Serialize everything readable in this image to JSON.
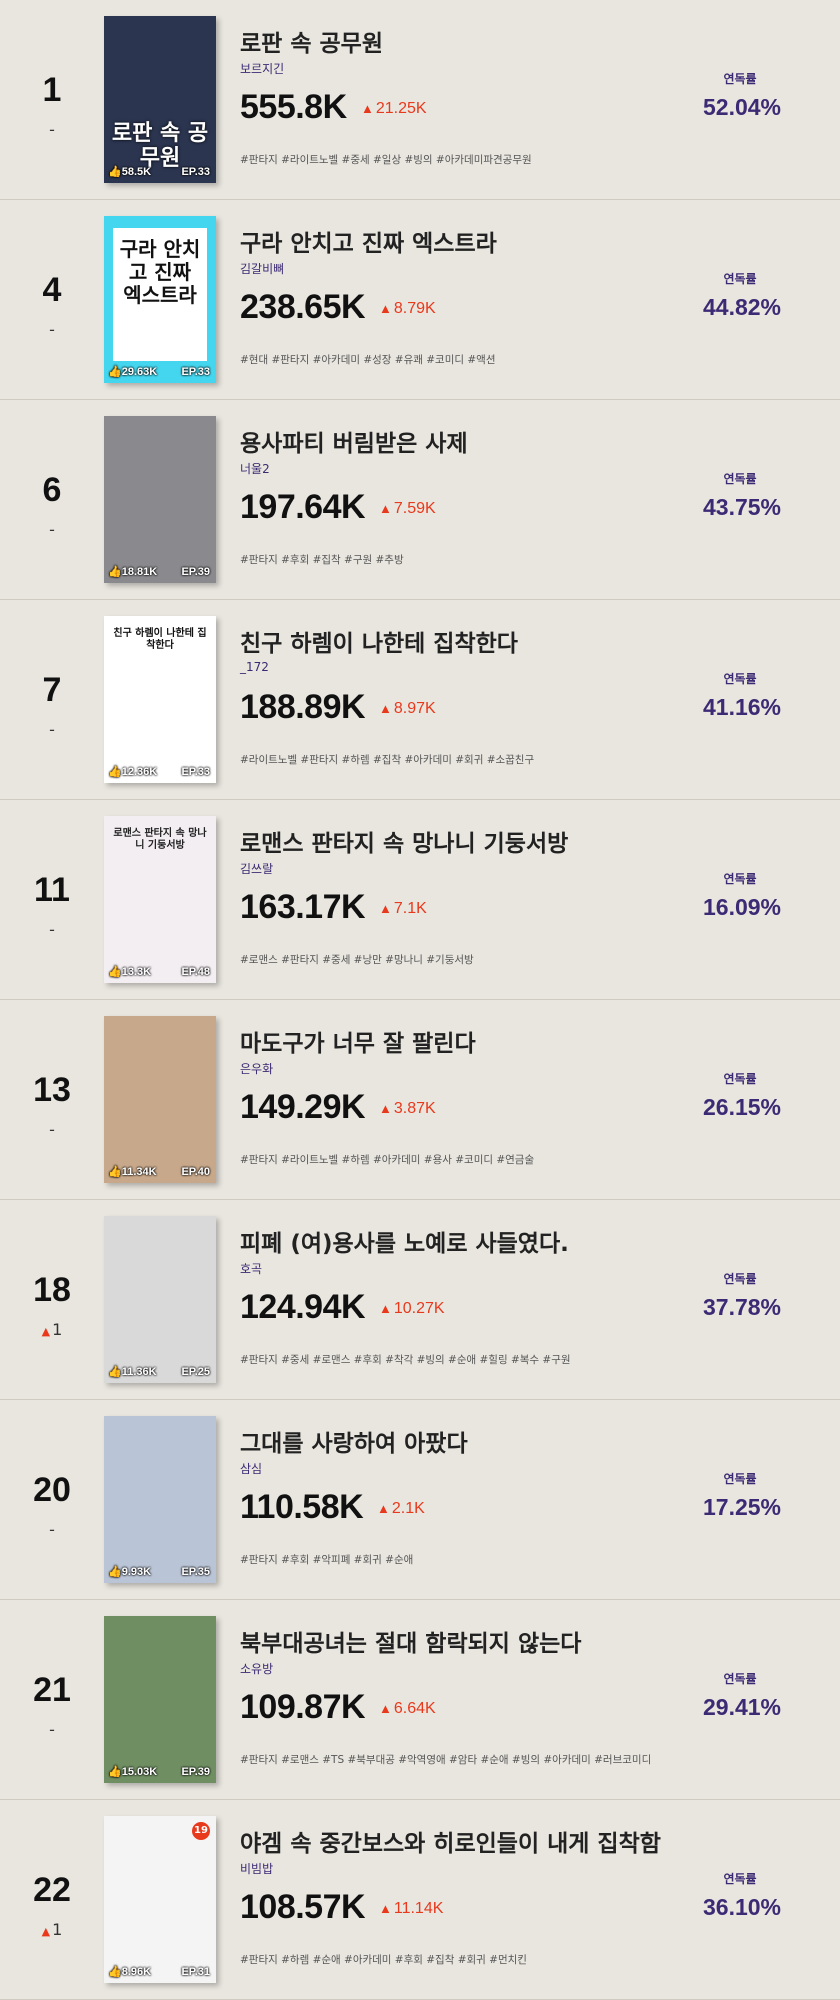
{
  "rows": [
    {
      "rank": "1",
      "change": "-",
      "change_up": false,
      "title": "로판 속 공무원",
      "author": "보르지긴",
      "views": "555.8K",
      "increase": "21.25K",
      "tags": "#판타지 #라이트노벨 #중세 #일상 #빙의 #아카데미파견공무원",
      "rate_label": "연독률",
      "rate": "52.04%",
      "likes": "58.5K",
      "ep": "EP.33",
      "cover_text": "로판 속 공무원",
      "cover_bg": "#2b3550",
      "cover_fg": "#ffffff",
      "cover_text_pos": "bottom",
      "age": ""
    },
    {
      "rank": "4",
      "change": "-",
      "change_up": false,
      "title": "구라 안치고 진짜 엑스트라",
      "author": "김갈비뼈",
      "views": "238.65K",
      "increase": "8.79K",
      "tags": "#현대 #판타지 #아카데미 #성장 #유쾌 #코미디 #액션",
      "rate_label": "연독률",
      "rate": "44.82%",
      "likes": "29.63K",
      "ep": "EP.33",
      "cover_text": "구라 안치고 진짜 엑스트라",
      "cover_bg": "#43d6ee",
      "cover_fg": "#111111",
      "cover_text_pos": "center",
      "age": ""
    },
    {
      "rank": "6",
      "change": "-",
      "change_up": false,
      "title": "용사파티 버림받은 사제",
      "author": "너울2",
      "views": "197.64K",
      "increase": "7.59K",
      "tags": "#판타지 #후회 #집착 #구원 #추방",
      "rate_label": "연독률",
      "rate": "43.75%",
      "likes": "18.81K",
      "ep": "EP.39",
      "cover_text": "",
      "cover_bg": "#8a8a8e",
      "cover_fg": "#ffffff",
      "cover_text_pos": "center",
      "age": ""
    },
    {
      "rank": "7",
      "change": "-",
      "change_up": false,
      "title": "친구 하렘이 나한테 집착한다",
      "author": "_172",
      "views": "188.89K",
      "increase": "8.97K",
      "tags": "#라이트노벨 #판타지 #하렘 #집착 #아카데미 #회귀 #소꿉친구",
      "rate_label": "연독률",
      "rate": "41.16%",
      "likes": "12.36K",
      "ep": "EP.33",
      "cover_text": "친구 하렘이 나한테 집착한다",
      "cover_bg": "#ffffff",
      "cover_fg": "#111111",
      "cover_text_pos": "top",
      "age": ""
    },
    {
      "rank": "11",
      "change": "-",
      "change_up": false,
      "title": "로맨스 판타지 속 망나니 기둥서방",
      "author": "김쓰랄",
      "views": "163.17K",
      "increase": "7.1K",
      "tags": "#로맨스 #판타지 #중세 #낭만 #망나니 #기둥서방",
      "rate_label": "연독률",
      "rate": "16.09%",
      "likes": "13.3K",
      "ep": "EP.48",
      "cover_text": "로맨스 판타지 속 망나니 기둥서방",
      "cover_bg": "#f3eef2",
      "cover_fg": "#222222",
      "cover_text_pos": "top",
      "age": ""
    },
    {
      "rank": "13",
      "change": "-",
      "change_up": false,
      "title": "마도구가 너무 잘 팔린다",
      "author": "은우화",
      "views": "149.29K",
      "increase": "3.87K",
      "tags": "#판타지 #라이트노벨 #하렘 #아카데미 #용사 #코미디 #연금술",
      "rate_label": "연독률",
      "rate": "26.15%",
      "likes": "11.34K",
      "ep": "EP.40",
      "cover_text": "",
      "cover_bg": "#c8a88a",
      "cover_fg": "#ffffff",
      "cover_text_pos": "center",
      "age": ""
    },
    {
      "rank": "18",
      "change": "1",
      "change_up": true,
      "title": "피폐 (여)용사를 노예로 사들였다.",
      "author": "호곡",
      "views": "124.94K",
      "increase": "10.27K",
      "tags": "#판타지 #중세 #로맨스 #후회 #착각 #빙의 #순애 #힐링 #복수 #구원",
      "rate_label": "연독률",
      "rate": "37.78%",
      "likes": "11.36K",
      "ep": "EP.25",
      "cover_text": "",
      "cover_bg": "#d9d9d9",
      "cover_fg": "#ffffff",
      "cover_text_pos": "center",
      "age": ""
    },
    {
      "rank": "20",
      "change": "-",
      "change_up": false,
      "title": "그대를 사랑하여 아팠다",
      "author": "삼심",
      "views": "110.58K",
      "increase": "2.1K",
      "tags": "#판타지 #후회 #악피폐 #회귀 #순애",
      "rate_label": "연독률",
      "rate": "17.25%",
      "likes": "9.93K",
      "ep": "EP.35",
      "cover_text": "",
      "cover_bg": "#b9c4d6",
      "cover_fg": "#ffffff",
      "cover_text_pos": "center",
      "age": ""
    },
    {
      "rank": "21",
      "change": "-",
      "change_up": false,
      "title": "북부대공녀는 절대 함락되지 않는다",
      "author": "소유방",
      "views": "109.87K",
      "increase": "6.64K",
      "tags": "#판타지 #로맨스 #TS #북부대공 #악역영애 #암타 #순애 #빙의 #아카데미 #러브코미디",
      "rate_label": "연독률",
      "rate": "29.41%",
      "likes": "15.03K",
      "ep": "EP.39",
      "cover_text": "",
      "cover_bg": "#6f8f62",
      "cover_fg": "#ffffff",
      "cover_text_pos": "center",
      "age": ""
    },
    {
      "rank": "22",
      "change": "1",
      "change_up": true,
      "title": "야겜 속 중간보스와 히로인들이 내게 집착함",
      "author": "비빔밥",
      "views": "108.57K",
      "increase": "11.14K",
      "tags": "#판타지 #하렘 #순애 #아카데미 #후회 #집착 #회귀 #먼치킨",
      "rate_label": "연독률",
      "rate": "36.10%",
      "likes": "8.96K",
      "ep": "EP.31",
      "cover_text": "",
      "cover_bg": "#f4f4f4",
      "cover_fg": "#ffffff",
      "cover_text_pos": "center",
      "age": "19"
    }
  ]
}
